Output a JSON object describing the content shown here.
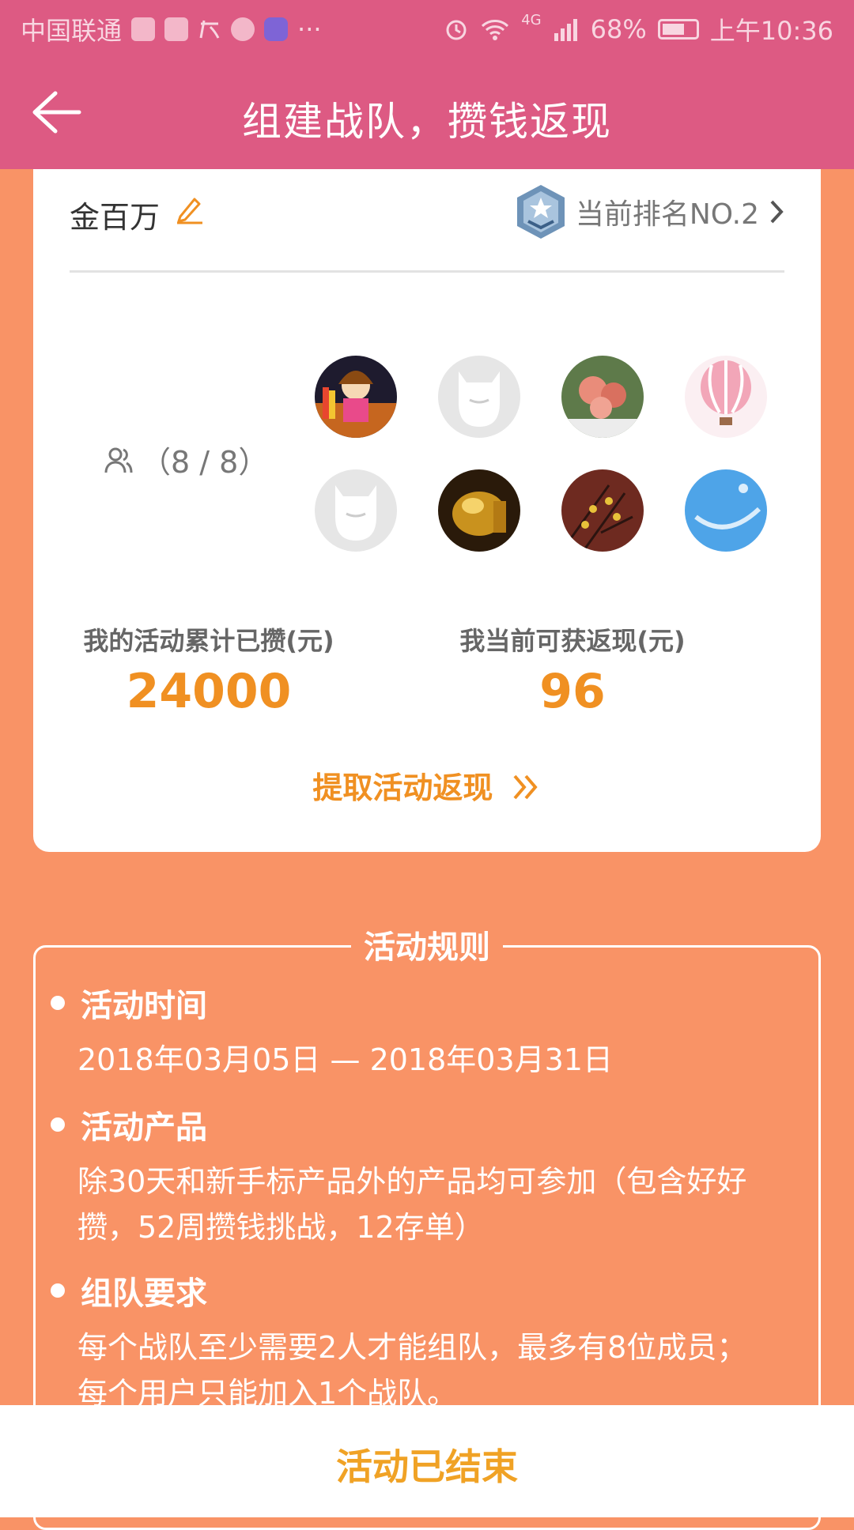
{
  "status_bar": {
    "carrier": "中国联通",
    "network": "4G",
    "battery": "68%",
    "time": "上午10:36",
    "icons": [
      "sim-icon",
      "map-icon",
      "pay-icon",
      "hand-icon",
      "app-icon",
      "more-icon",
      "alarm-icon",
      "wifi-icon",
      "signal-icon",
      "battery-icon"
    ]
  },
  "header": {
    "title": "组建战队，攒钱返现"
  },
  "team": {
    "name": "金百万",
    "rank": "当前排名NO.2",
    "member_count": "（8 / 8）"
  },
  "stats": {
    "saved_label": "我的活动累计已攒(元)",
    "saved_value": "24000",
    "cashback_label": "我当前可获返现(元)",
    "cashback_value": "96"
  },
  "withdraw_label": "提取活动返现",
  "rules": {
    "title": "活动规则",
    "items": [
      {
        "heading": "活动时间",
        "body": "2018年03月05日 — 2018年03月31日"
      },
      {
        "heading": "活动产品",
        "body": "除30天和新手标产品外的产品均可参加（包含好好攒，52周攒钱挑战，12存单）"
      },
      {
        "heading": "组队要求",
        "body": "每个战队至少需要2人才能组队，最多有8位成员；每个用户只能加入1个战队。"
      }
    ]
  },
  "footer": {
    "status": "活动已结束"
  },
  "colors": {
    "header_bg": "#DD5A83",
    "page_bg": "#F99366",
    "accent": "#F09022"
  }
}
